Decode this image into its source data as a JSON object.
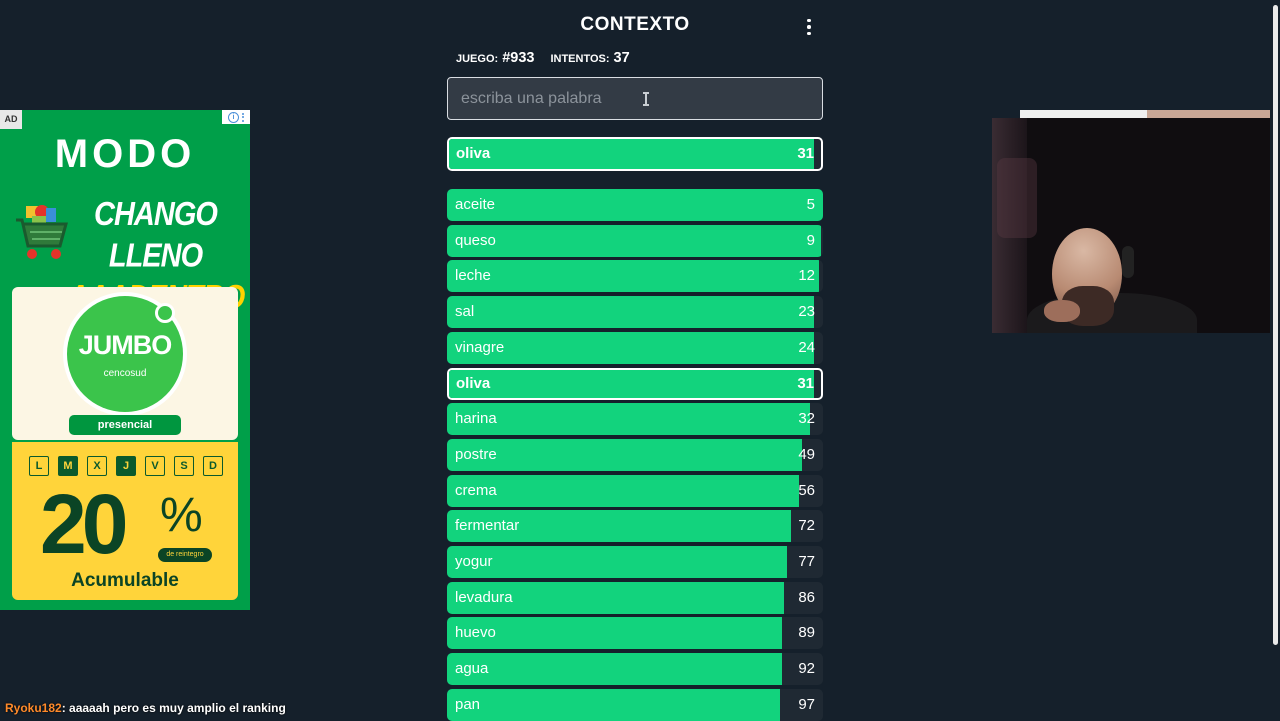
{
  "header": {
    "title": "CONTEXTO",
    "game_label": "JUEGO:",
    "game_number": "#933",
    "attempts_label": "INTENTOS:",
    "attempts_value": "37"
  },
  "input": {
    "placeholder": "escriba una palabra",
    "value": ""
  },
  "last_guess": {
    "word": "oliva",
    "distance": "31",
    "fill": 0.97
  },
  "guesses": [
    {
      "word": "aceite",
      "distance": "5",
      "fill": 1.0,
      "highlight": false
    },
    {
      "word": "queso",
      "distance": "9",
      "fill": 0.995,
      "highlight": false
    },
    {
      "word": "leche",
      "distance": "12",
      "fill": 0.99,
      "highlight": false
    },
    {
      "word": "sal",
      "distance": "23",
      "fill": 0.975,
      "highlight": false
    },
    {
      "word": "vinagre",
      "distance": "24",
      "fill": 0.975,
      "highlight": false
    },
    {
      "word": "oliva",
      "distance": "31",
      "fill": 0.97,
      "highlight": true
    },
    {
      "word": "harina",
      "distance": "32",
      "fill": 0.965,
      "highlight": false
    },
    {
      "word": "postre",
      "distance": "49",
      "fill": 0.945,
      "highlight": false
    },
    {
      "word": "crema",
      "distance": "56",
      "fill": 0.935,
      "highlight": false
    },
    {
      "word": "fermentar",
      "distance": "72",
      "fill": 0.915,
      "highlight": false
    },
    {
      "word": "yogur",
      "distance": "77",
      "fill": 0.905,
      "highlight": false
    },
    {
      "word": "levadura",
      "distance": "86",
      "fill": 0.895,
      "highlight": false
    },
    {
      "word": "huevo",
      "distance": "89",
      "fill": 0.89,
      "highlight": false
    },
    {
      "word": "agua",
      "distance": "92",
      "fill": 0.89,
      "highlight": false
    },
    {
      "word": "pan",
      "distance": "97",
      "fill": 0.885,
      "highlight": false
    }
  ],
  "ad": {
    "badge": "AD",
    "brand": "MODO",
    "headline_1": "CHANGO LLENO",
    "headline_2": "AAADENTRO",
    "store_name": "JUMBO",
    "store_sub": "cencosud",
    "store_tag": "presencial",
    "days": [
      "L",
      "M",
      "X",
      "J",
      "V",
      "S",
      "D"
    ],
    "active_days": [
      "M",
      "J"
    ],
    "discount": "20",
    "discount_sign": "%",
    "discount_note": "de reintegro",
    "discount_tag": "Acumulable"
  },
  "chat": {
    "user": "Ryoku182",
    "message": ": aaaaah pero es muy amplio el ranking"
  },
  "colors": {
    "background": "#15202b",
    "bar_green": "#12d37d",
    "row_track": "#1f2933",
    "input_bg": "#333b45",
    "ad_green": "#009f49",
    "ad_yellow": "#ffd43a",
    "chat_user": "#ff8a2a"
  },
  "icons": {
    "menu": "more-vert-icon",
    "text_cursor": "i-beam-cursor-icon",
    "ad_info": "info-icon"
  }
}
